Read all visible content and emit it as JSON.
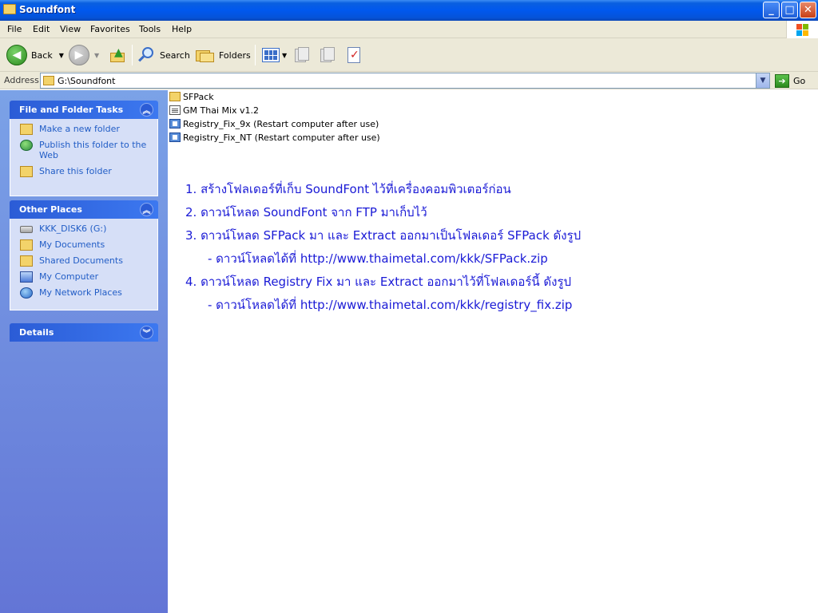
{
  "window": {
    "title": "Soundfont",
    "controls": {
      "minimize": "_",
      "maximize": "□",
      "close": "✕"
    }
  },
  "menu": [
    "File",
    "Edit",
    "View",
    "Favorites",
    "Tools",
    "Help"
  ],
  "toolbar": {
    "back_label": "Back",
    "search_label": "Search",
    "folders_label": "Folders"
  },
  "address": {
    "label": "Address",
    "value": "G:\\Soundfont",
    "go_label": "Go"
  },
  "task_pane": {
    "file_tasks": {
      "title": "File and Folder Tasks",
      "items": [
        "Make a new folder",
        "Publish this folder to the Web",
        "Share this folder"
      ]
    },
    "other_places": {
      "title": "Other Places",
      "items": [
        "KKK_DISK6 (G:)",
        "My Documents",
        "Shared Documents",
        "My Computer",
        "My Network Places"
      ]
    },
    "details": {
      "title": "Details"
    }
  },
  "files": [
    {
      "name": "SFPack",
      "type": "folder"
    },
    {
      "name": "GM Thai Mix v1.2",
      "type": "document"
    },
    {
      "name": "Registry_Fix_9x (Restart computer after use)",
      "type": "registry"
    },
    {
      "name": "Registry_Fix_NT (Restart computer after use)",
      "type": "registry"
    }
  ],
  "instructions": [
    "1. สร้างโฟลเดอร์ที่เก็บ SoundFont ไว้ที่เครื่องคอมพิวเตอร์ก่อน",
    "2. ดาวน์โหลด SoundFont จาก FTP มาเก็บไว้",
    "3. ดาวน์โหลด SFPack มา และ Extract ออกมาเป็นโฟลเดอร์ SFPack ดังรูป",
    "- ดาวน์โหลดได้ที่ http://www.thaimetal.com/kkk/SFPack.zip",
    "4. ดาวน์โหลด Registry Fix มา และ Extract ออกมาไว้ที่โฟลเดอร์นี้ ดังรูป",
    "- ดาวน์โหลดได้ที่ http://www.thaimetal.com/kkk/registry_fix.zip"
  ]
}
